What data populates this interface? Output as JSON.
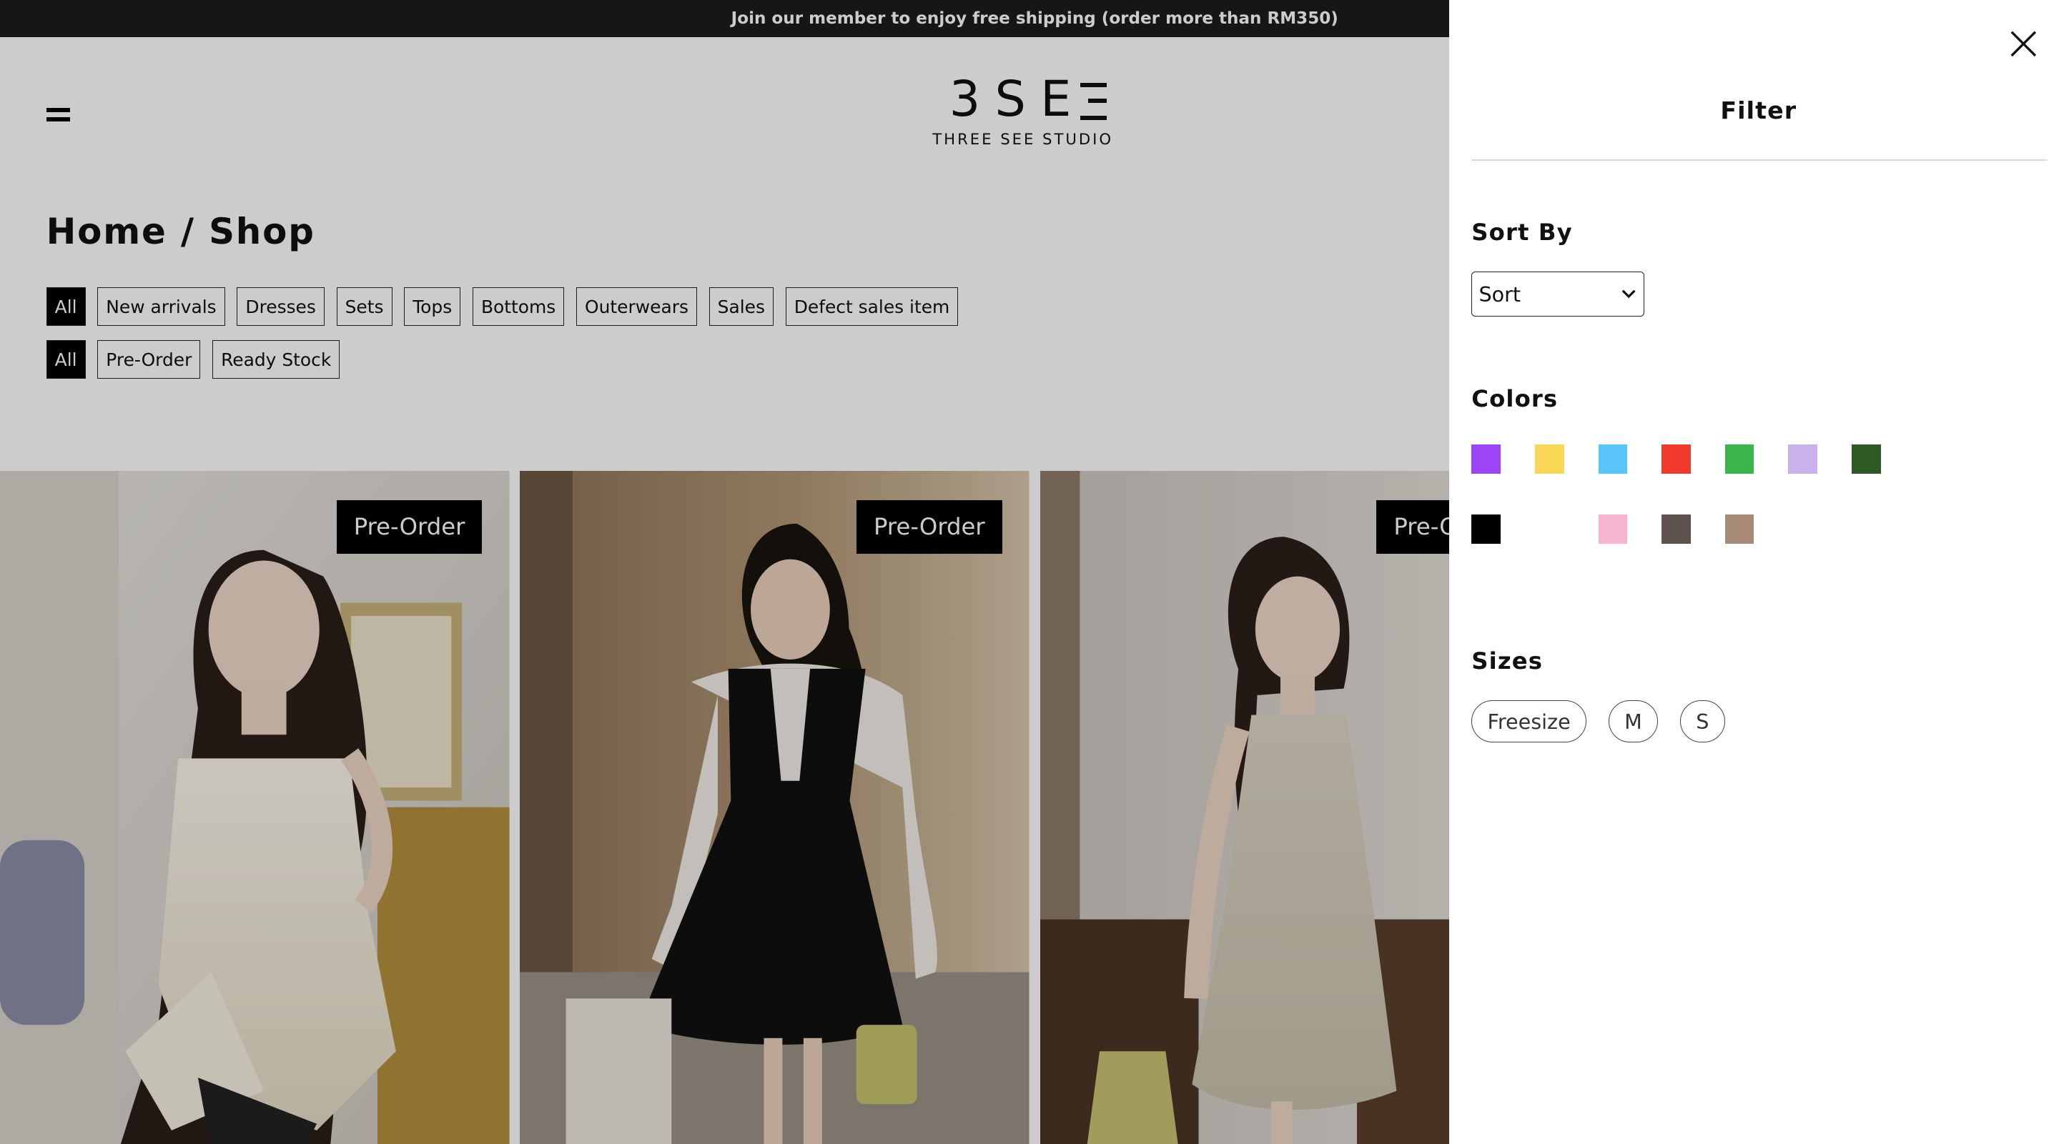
{
  "announcement": "Join our member to enjoy free shipping (order more than RM350)",
  "header": {
    "logo_mark": "3SE",
    "logo_subtitle": "THREE SEE STUDIO",
    "menu_icon": "hamburger-menu-icon"
  },
  "breadcrumb": "Home / Shop",
  "category_filters": [
    "All",
    "New arrivals",
    "Dresses",
    "Sets",
    "Tops",
    "Bottoms",
    "Outerwears",
    "Sales",
    "Defect sales item"
  ],
  "stock_filters": [
    "All",
    "Pre-Order",
    "Ready Stock"
  ],
  "products": [
    {
      "badge": "Pre-Order"
    },
    {
      "badge": "Pre-Order"
    },
    {
      "badge": "Pre-Order"
    }
  ],
  "filter_panel": {
    "title": "Filter",
    "close_icon": "close-icon",
    "sort_label": "Sort By",
    "sort_value": "Sort",
    "colors_label": "Colors",
    "colors": [
      "#9b45f5",
      "#fad857",
      "#5ac5f8",
      "#f03a2e",
      "#3bb54a",
      "#c9b1ec",
      "#2c5a22",
      "#000000",
      "#ffffff",
      "#f5b4cf",
      "#5c534e",
      "#a88a78"
    ],
    "sizes_label": "Sizes",
    "sizes": [
      "Freesize",
      "M",
      "S"
    ]
  }
}
